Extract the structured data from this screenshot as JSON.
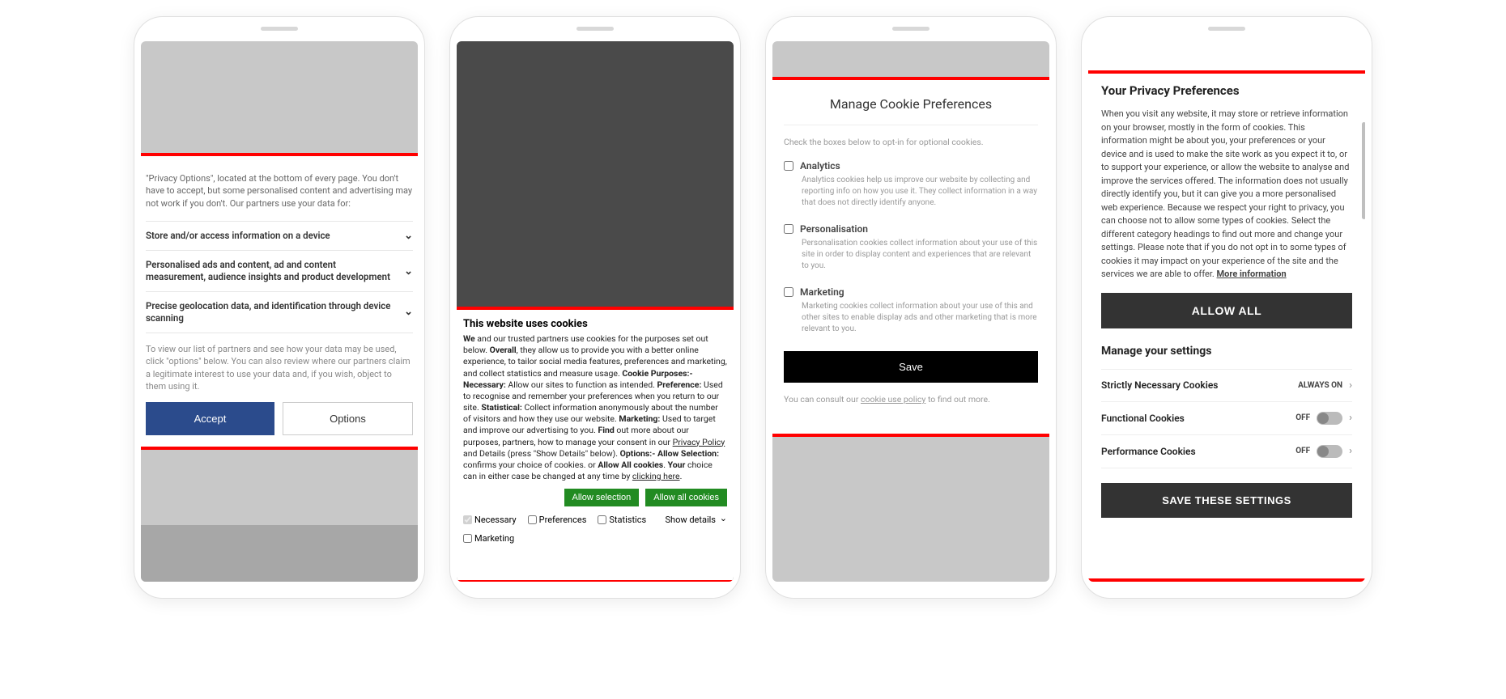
{
  "phone1": {
    "intro": "\"Privacy Options\", located at the bottom of every page. You don't have to accept, but some personalised content and advertising may not work if you don't. Our partners use your data for:",
    "rows": [
      "Store and/or access information on a device",
      "Personalised ads and content, ad and content measurement, audience insights and product development",
      "Precise geolocation data, and identification through device scanning"
    ],
    "footer_text": "To view our list of partners and see how your data may be used, click \"options\" below. You can also review where our partners claim a legitimate interest to use your data and, if you wish, object to them using it.",
    "accept": "Accept",
    "options": "Options"
  },
  "phone2": {
    "title": "This website uses cookies",
    "allow_selection": "Allow selection",
    "allow_all": "Allow all cookies",
    "necessary": "Necessary",
    "preferences": "Preferences",
    "statistics": "Statistics",
    "marketing": "Marketing",
    "show_details": "Show details",
    "t_we": "We",
    "t_we2": " and our trusted partners use cookies for the purposes set out below. ",
    "t_overall": "Overall",
    "t_overall2": ", they allow us to provide you with a better online experience, to tailor social media features, preferences and marketing, and collect statistics and measure usage. ",
    "t_cp": "Cookie Purposes:- Necessary:",
    "t_cp2": " Allow our sites to function as intended. ",
    "t_pref": "Preference:",
    "t_pref2": " Used to recognise and remember your preferences when you return to our site. ",
    "t_stat": "Statistical:",
    "t_stat2": " Collect information anonymously about the number of visitors and how they use our website. ",
    "t_mkt": "Marketing:",
    "t_mkt2": " Used to target and improve our advertising to you. ",
    "t_find": "Find",
    "t_find2": " out more about our purposes, partners, how to manage your consent in our ",
    "t_pp": "Privacy Policy",
    "t_sd": " and Details (press \"Show Details\" below). ",
    "t_opt": "Options:- Allow Selection:",
    "t_opt2": " confirms your choice of cookies. or ",
    "t_all": "Allow All cookies",
    "t_dot": ". ",
    "t_your": "Your",
    "t_your2": " choice can in either case be changed at any time by ",
    "t_ch": "clicking here",
    "t_end": "."
  },
  "phone3": {
    "title": "Manage Cookie Preferences",
    "intro": "Check the boxes below to opt-in for optional cookies.",
    "analytics": "Analytics",
    "analytics_desc": "Analytics cookies help us improve our website by collecting and reporting info on how you use it. They collect information in a way that does not directly identify anyone.",
    "personalisation": "Personalisation",
    "personalisation_desc": "Personalisation cookies collect information about your use of this site in order to display content and experiences that are relevant to you.",
    "marketing": "Marketing",
    "marketing_desc": "Marketing cookies collect information about your use of this and other sites to enable display ads and other marketing that is more relevant to you.",
    "save": "Save",
    "foot1": "You can consult our ",
    "foot_link": "cookie use policy",
    "foot2": " to find out more."
  },
  "phone4": {
    "title": "Your Privacy Preferences",
    "body": "When you visit any website, it may store or retrieve information on your browser, mostly in the form of cookies. This information might be about you, your preferences or your device and is used to make the site work as you expect it to, or to support your experience, or allow the website to analyse and improve the services offered. The information does not usually directly identify you, but it can give you a more personalised web experience. Because we respect your right to privacy, you can choose not to allow some types of cookies. Select the different category headings to find out more and change your settings. Please note that if you do not opt in to some types of cookies it may impact on your experience of the site and the services we are able to offer.  ",
    "more_info": "More information",
    "allow_all": "ALLOW ALL",
    "manage": "Manage your settings",
    "s1": "Strictly Necessary Cookies",
    "s1_state": "ALWAYS ON",
    "s2": "Functional Cookies",
    "s2_state": "OFF",
    "s3": "Performance Cookies",
    "s3_state": "OFF",
    "save": "SAVE THESE SETTINGS"
  }
}
